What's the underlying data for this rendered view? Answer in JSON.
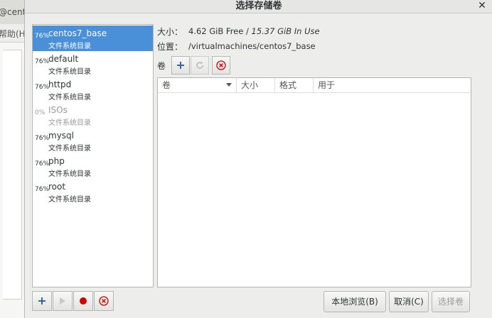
{
  "background_window": {
    "title_fragment": "@cent",
    "menu_fragment": "帮助(H"
  },
  "dialog": {
    "title": "选择存储卷"
  },
  "pools": [
    {
      "pct": "76%",
      "name": "centos7_base",
      "type": "文件系统目录",
      "selected": true
    },
    {
      "pct": "76%",
      "name": "default",
      "type": "文件系统目录"
    },
    {
      "pct": "76%",
      "name": "httpd",
      "type": "文件系统目录"
    },
    {
      "pct": "0%",
      "name": "ISOs",
      "type": "文件系统目录",
      "inactive": true
    },
    {
      "pct": "76%",
      "name": "mysql",
      "type": "文件系统目录"
    },
    {
      "pct": "76%",
      "name": "php",
      "type": "文件系统目录"
    },
    {
      "pct": "76%",
      "name": "root",
      "type": "文件系统目录"
    }
  ],
  "details": {
    "size_label": "大小：",
    "size_free": "4.62 GiB Free / ",
    "size_in_use": "15.37 GiB In Use",
    "location_label": "位置：",
    "location_value": "/virtualmachines/centos7_base"
  },
  "volumes": {
    "label": "卷",
    "columns": [
      "卷",
      "大小",
      "格式",
      "用于"
    ],
    "rows": []
  },
  "buttons": {
    "browse_local": "本地浏览(B)",
    "cancel": "取消(C)",
    "choose_volume": "选择卷"
  },
  "colors": {
    "selection": "#4a90d9",
    "add_icon": "#3465a4",
    "record_icon": "#cc0000",
    "delete_icon": "#cc0000"
  }
}
